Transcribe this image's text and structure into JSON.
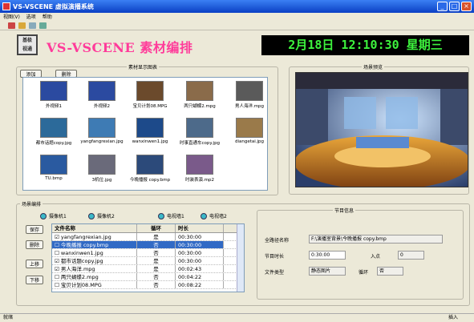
{
  "window": {
    "title": "VS-VSCENE 虚拟演播系统",
    "min": "_",
    "max": "□",
    "close": "×"
  },
  "menu": [
    "视图(V)",
    "选项",
    "帮助"
  ],
  "header": {
    "logo_line1": "基极",
    "logo_line2": "视通",
    "app_title": "VS-VSCENE 素材编排",
    "clock": "2月18日 12:10:30 星期三"
  },
  "materials": {
    "legend": "素材显示图表",
    "add": "添加",
    "delete": "删除",
    "items": [
      {
        "label": "外视频1",
        "color": "#2b4aa0"
      },
      {
        "label": "外视频2",
        "color": "#2b4aa0"
      },
      {
        "label": "宝贝计划08.MPG",
        "color": "#6b4a2c"
      },
      {
        "label": "两只蝴蝶2.mpg",
        "color": "#8a6b4a"
      },
      {
        "label": "男人海洋.mpg",
        "color": "#5a5a5a"
      },
      {
        "label": "都市话题copy.jpg",
        "color": "#2c6a9a"
      },
      {
        "label": "yangfangrexian.jpg",
        "color": "#3e7bb4"
      },
      {
        "label": "wanxinwen1.jpg",
        "color": "#1d4a8a"
      },
      {
        "label": "时事直通车copy.jpg",
        "color": "#4d6a8a"
      },
      {
        "label": "diangetai.jpg",
        "color": "#9a7a4a"
      },
      {
        "label": "TU.bmp",
        "color": "#2a5aa0"
      },
      {
        "label": "3机位.jpg",
        "color": "#6a6a7a"
      },
      {
        "label": "今晚播报 copy.bmp",
        "color": "#2c4a7a"
      },
      {
        "label": "时装表演.mp2",
        "color": "#7a5a8a"
      }
    ]
  },
  "preview": {
    "legend": "场景预览"
  },
  "scene": {
    "legend": "场景编排",
    "radios": [
      "摄像机1",
      "摄像机2",
      "电视墙1",
      "电视墙2"
    ],
    "buttons": {
      "save": "保存",
      "delete": "删除",
      "up": "上移",
      "down": "下移"
    },
    "columns": [
      "文件名称",
      "循环",
      "时长"
    ],
    "rows": [
      {
        "name": "yangfangrexian.jpg",
        "loop": "是",
        "dur": "00:30:00",
        "checked": true,
        "sel": false
      },
      {
        "name": "今晚播报 copy.bmp",
        "loop": "否",
        "dur": "00:30:00",
        "checked": false,
        "sel": true
      },
      {
        "name": "wanxinwen1.jpg",
        "loop": "否",
        "dur": "00:30:00",
        "checked": false,
        "sel": false
      },
      {
        "name": "都市话题copy.jpg",
        "loop": "是",
        "dur": "00:30:00",
        "checked": true,
        "sel": false
      },
      {
        "name": "男人海洋.mpg",
        "loop": "是",
        "dur": "00:02:43",
        "checked": true,
        "sel": false
      },
      {
        "name": "两只蝴蝶2.mpg",
        "loop": "否",
        "dur": "00:04:22",
        "checked": false,
        "sel": false
      },
      {
        "name": "宝贝计划08.MPG",
        "loop": "否",
        "dur": "00:08:22",
        "checked": false,
        "sel": false
      }
    ]
  },
  "info": {
    "legend": "节目信息",
    "path_label": "全路径名称",
    "path_value": "F:\\演播室背景\\今晚播报 copy.bmp",
    "dur_label": "节目时长",
    "dur_value": "0:30:00",
    "in_label": "入点",
    "in_value": "0",
    "type_label": "文件类型",
    "type_value": "静态图片",
    "loop_label": "循环",
    "loop_value": "否"
  },
  "status": {
    "left": "就绪",
    "right": "插入"
  }
}
